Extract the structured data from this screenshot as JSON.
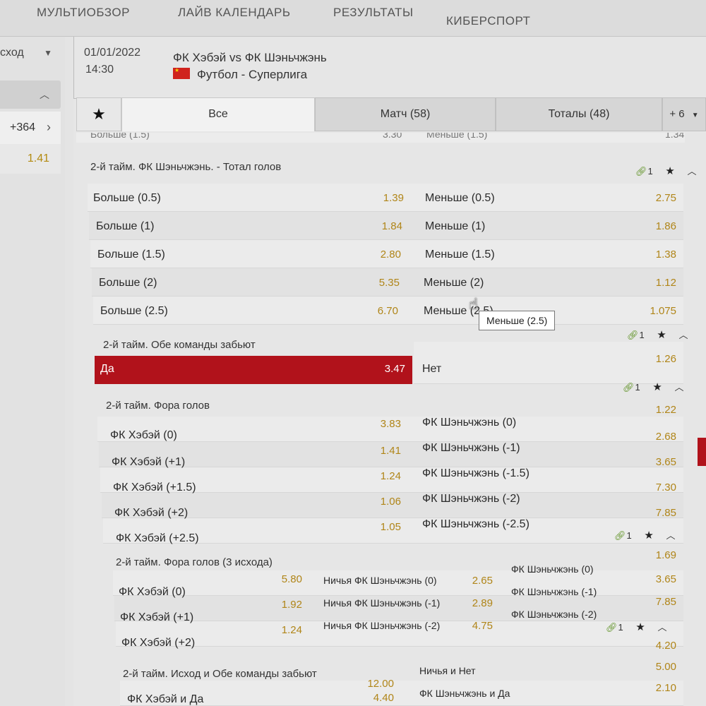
{
  "topnav": [
    "МУЛЬТИОБЗОР",
    "ЛАЙВ КАЛЕНДАРЬ",
    "РЕЗУЛЬТАТЫ",
    "КИБЕРСПОРТ"
  ],
  "left": {
    "dropdown": "сход",
    "more": "+364",
    "odd": "1.41"
  },
  "match": {
    "date": "01/01/2022",
    "time": "14:30",
    "teams": "ФК Хэбэй vs ФК Шэньчжэнь",
    "league": "Футбол - Суперлига",
    "flag_color": "#d0231d"
  },
  "tabs": {
    "all": "Все",
    "match": "Матч (58)",
    "totals": "Тоталы (48)",
    "more": "+ 6"
  },
  "cut_row": {
    "left": "Больше (1.5)",
    "left_odd": "3.30",
    "right": "Меньше (1.5)",
    "right_odd": "1.34"
  },
  "markets": [
    {
      "title": "2-й тайм. ФК Шэньчжэнь. - Тотал голов",
      "links": "1",
      "rows": [
        {
          "l": "Больше (0.5)",
          "lo": "1.39",
          "r": "Меньше (0.5)",
          "ro": "2.75"
        },
        {
          "l": "Больше (1)",
          "lo": "1.84",
          "r": "Меньше (1)",
          "ro": "1.86"
        },
        {
          "l": "Больше (1.5)",
          "lo": "2.80",
          "r": "Меньше (1.5)",
          "ro": "1.38"
        },
        {
          "l": "Больше (2)",
          "lo": "5.35",
          "r": "Меньше (2)",
          "ro": "1.12"
        },
        {
          "l": "Больше (2.5)",
          "lo": "6.70",
          "r": "Меньше (2.5)",
          "ro": "1.075"
        }
      ]
    },
    {
      "title": "2-й тайм. Обе команды забьют",
      "links": "1",
      "rows": [
        {
          "l": "Да",
          "lo": "3.47",
          "r": "Нет",
          "ro": "1.26"
        }
      ]
    },
    {
      "title": "2-й тайм. Фора голов",
      "links": "1",
      "rows": [
        {
          "l": "ФК Хэбэй (0)",
          "lo": "3.83",
          "r": "ФК Шэньчжэнь (0)",
          "ro": "1.22"
        },
        {
          "l": "ФК Хэбэй (+1)",
          "lo": "1.41",
          "r": "ФК Шэньчжэнь (-1)",
          "ro": "2.68"
        },
        {
          "l": "ФК Хэбэй (+1.5)",
          "lo": "1.24",
          "r": "ФК Шэньчжэнь (-1.5)",
          "ro": "3.65"
        },
        {
          "l": "ФК Хэбэй (+2)",
          "lo": "1.06",
          "r": "ФК Шэньчжэнь (-2)",
          "ro": "7.30"
        },
        {
          "l": "ФК Хэбэй (+2.5)",
          "lo": "1.05",
          "r": "ФК Шэньчжэнь (-2.5)",
          "ro": "7.85"
        }
      ]
    },
    {
      "title": "2-й тайм. Фора голов (3 исхода)",
      "links": "1",
      "rows": [
        {
          "a": "ФК Хэбэй (0)",
          "ao": "5.80",
          "b": "Ничья ФК Шэньчжэнь (0)",
          "bo": "2.65",
          "c": "ФК Шэньчжэнь (0)",
          "co": "1.69"
        },
        {
          "a": "ФК Хэбэй (+1)",
          "ao": "1.92",
          "b": "Ничья ФК Шэньчжэнь (-1)",
          "bo": "2.89",
          "c": "ФК Шэньчжэнь (-1)",
          "co": "3.65"
        },
        {
          "a": "ФК Хэбэй (+2)",
          "ao": "1.24",
          "b": "Ничья ФК Шэньчжэнь (-2)",
          "bo": "4.75",
          "c": "ФК Шэньчжэнь (-2)",
          "co": "7.85"
        }
      ]
    },
    {
      "title": "2-й тайм. Исход и Обе команды забьют",
      "links": "1",
      "rows": [
        {
          "l": "ФК Хэбэй и Да",
          "lo": "12.00",
          "r": "Ничья и Нет",
          "ro": "4.20"
        },
        {
          "l": "",
          "lo": "4.40",
          "r": "ФК Шэньчжэнь и Да",
          "ro": "5.00"
        },
        {
          "l": "",
          "lo": "",
          "r": "",
          "ro": "2.10"
        }
      ]
    }
  ],
  "tooltip": "Меньше  (2.5)",
  "accent_color": "#b1121b",
  "odds_color": "#b08518"
}
